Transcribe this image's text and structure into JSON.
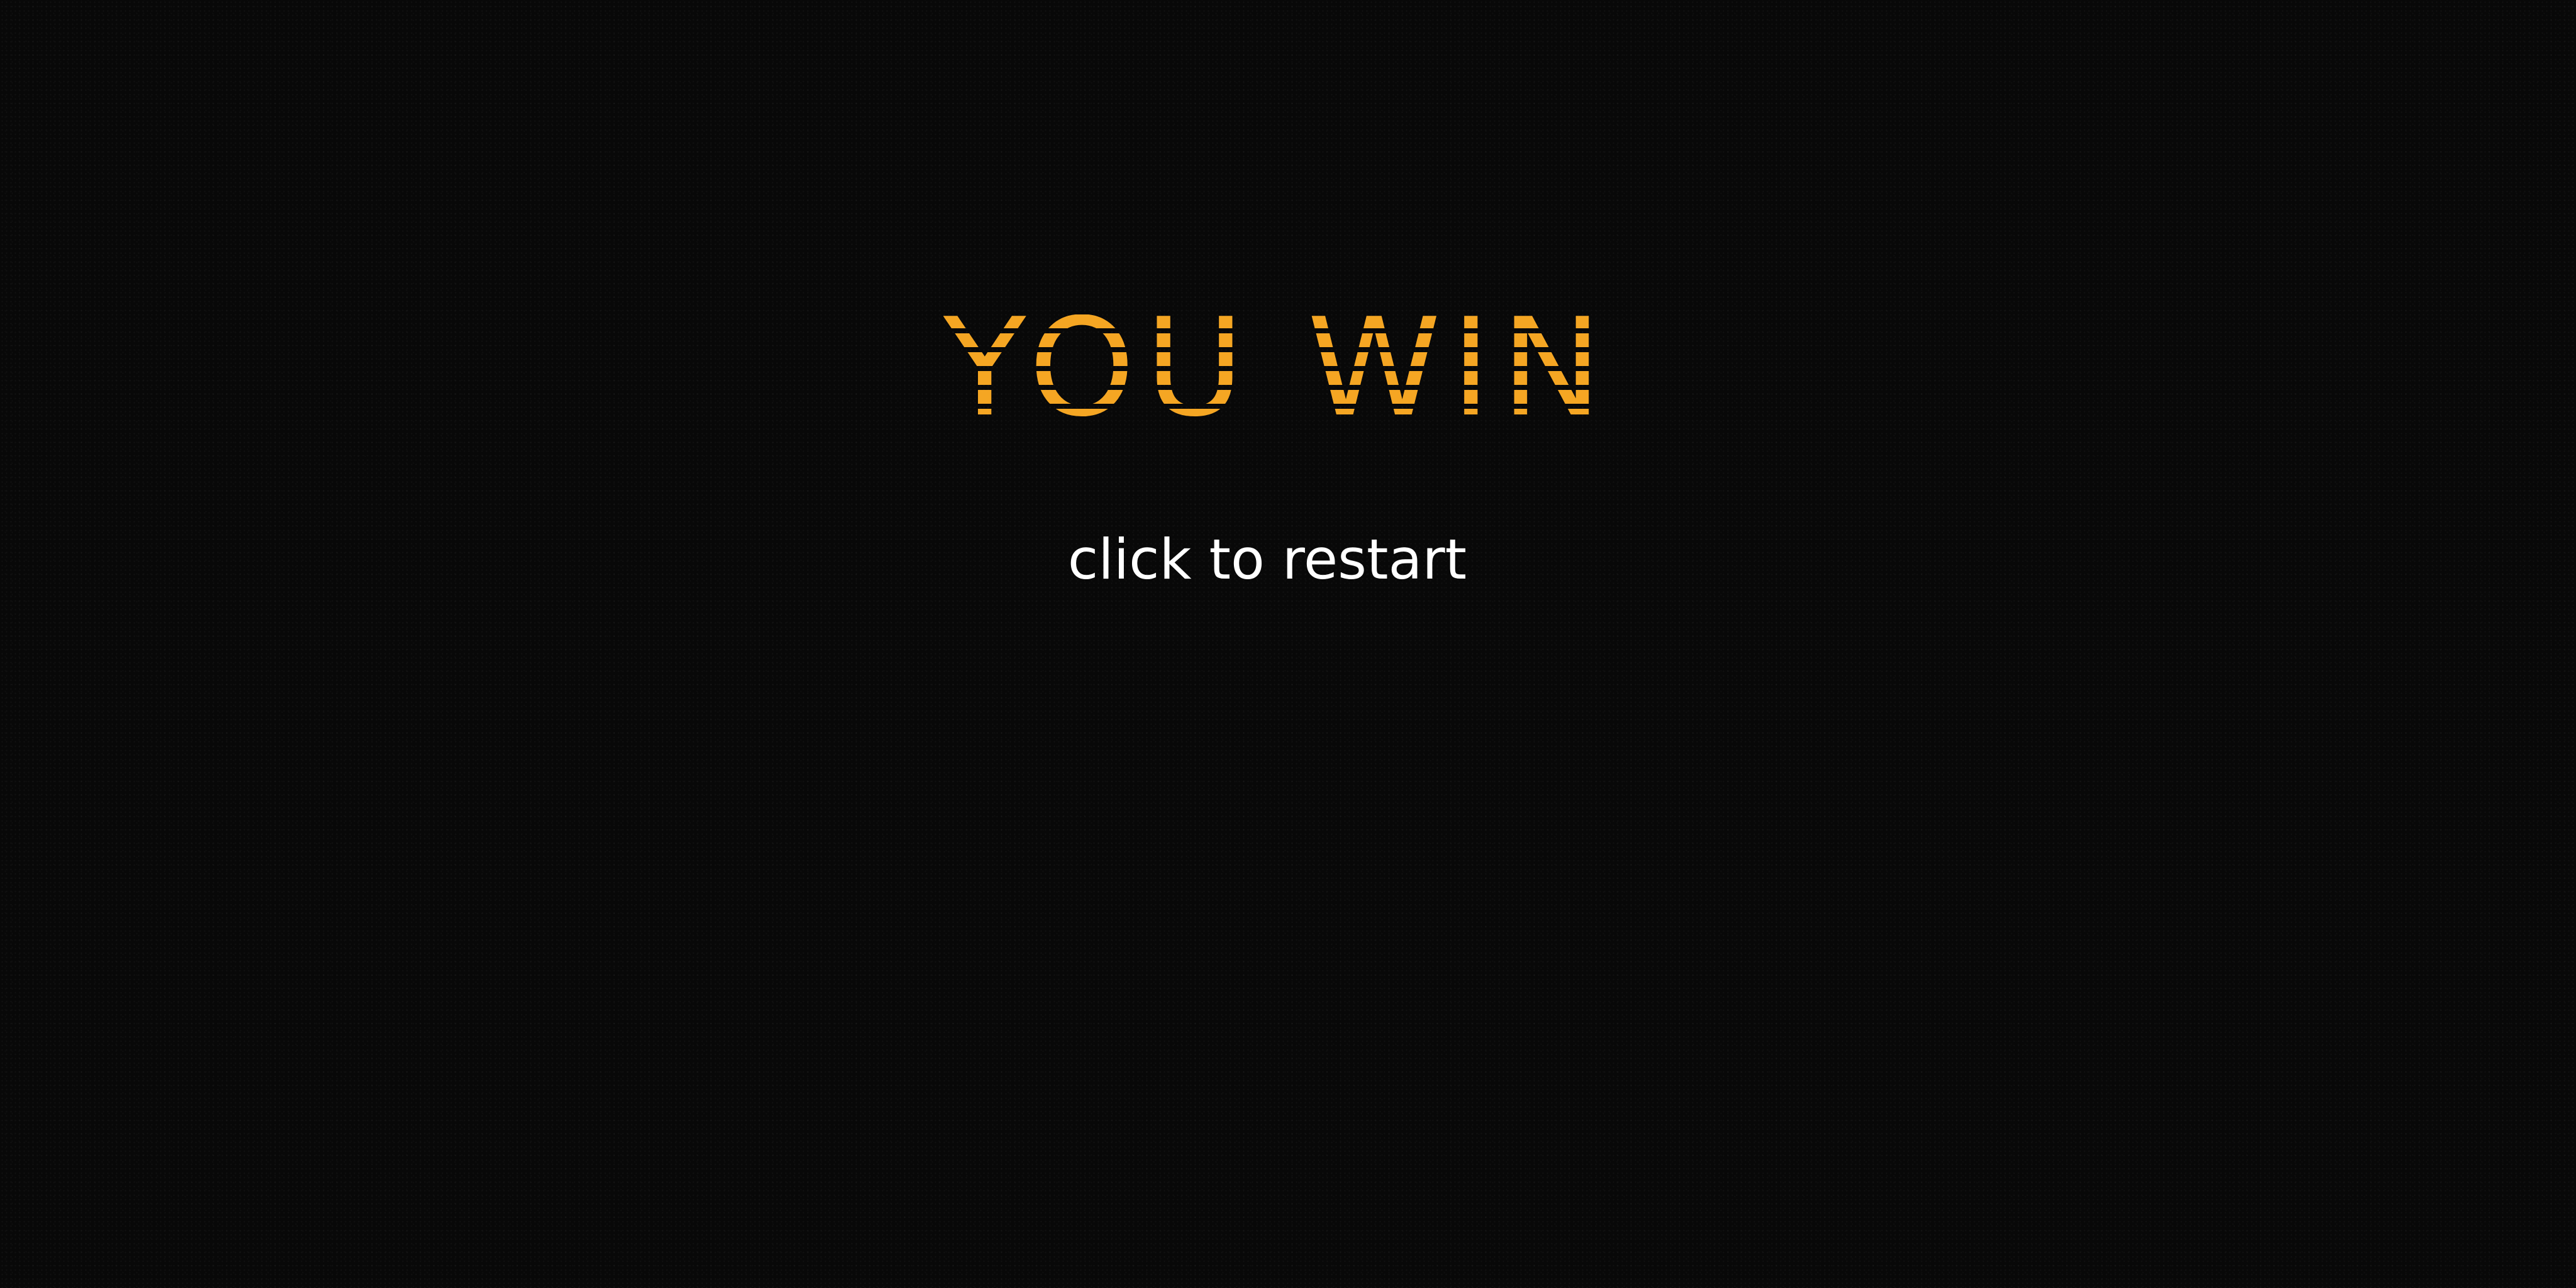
{
  "game_over": {
    "title": "YOU WIN!",
    "prompt": "click to restart",
    "colors": {
      "background": "#080808",
      "title": "#f5a623",
      "prompt": "#ffffff"
    }
  }
}
